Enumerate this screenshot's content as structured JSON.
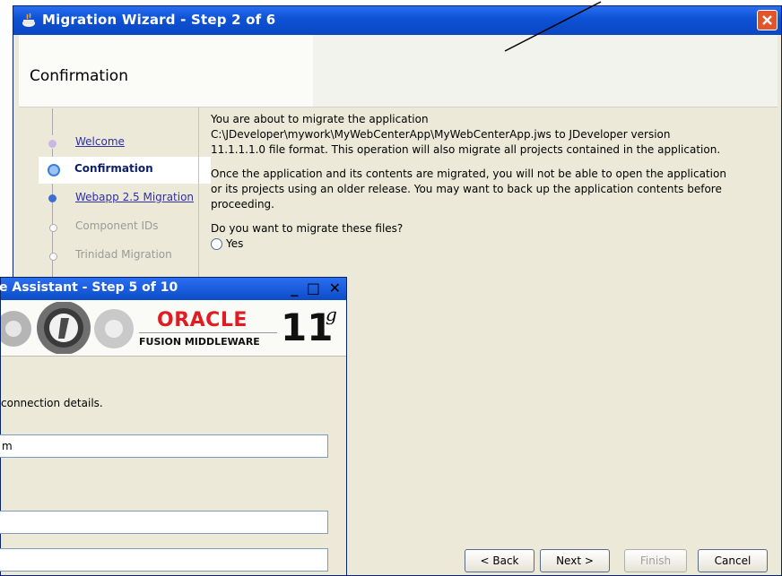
{
  "migration_wizard": {
    "title": "Migration Wizard - Step 2 of 6",
    "header": "Confirmation",
    "steps": [
      {
        "label": "Welcome",
        "state": "link"
      },
      {
        "label": "Confirmation",
        "state": "current"
      },
      {
        "label": "Webapp 2.5 Migration",
        "state": "link"
      },
      {
        "label": "Component IDs",
        "state": "disabled"
      },
      {
        "label": "Trinidad Migration",
        "state": "disabled"
      }
    ],
    "content": {
      "para1_line1": "You are about to migrate the application",
      "para1_line2": "C:\\JDeveloper\\mywork\\MyWebCenterApp\\MyWebCenterApp.jws to JDeveloper version",
      "para1_line3": "11.1.1.1.0 file format. This operation will also migrate all projects contained in the application.",
      "para2_line1": "Once the application and its contents are migrated, you will not be able to open the application",
      "para2_line2": "or its projects using an older release. You may want to back up the application contents before",
      "para2_line3": "proceeding.",
      "question": "Do you want to migrate these files?",
      "radio_yes": "Yes"
    },
    "buttons": {
      "back": "< Back",
      "next": "Next >",
      "finish": "Finish",
      "cancel": "Cancel"
    }
  },
  "upgrade_assistant": {
    "title": "e Assistant - Step 5 of 10",
    "window_controls": "_ □ X",
    "brand": {
      "oracle": "ORACLE",
      "fusion": "FUSION MIDDLEWARE",
      "version": "11",
      "version_sup": "g"
    },
    "instruction": "connection details.",
    "field1_value": "m",
    "field2_value": "",
    "field3_value": ""
  },
  "colors": {
    "title_bar": "#0f53d6",
    "oracle_red": "#e01b22",
    "window_bg": "#ece9d8",
    "link": "#2f2fa8"
  }
}
